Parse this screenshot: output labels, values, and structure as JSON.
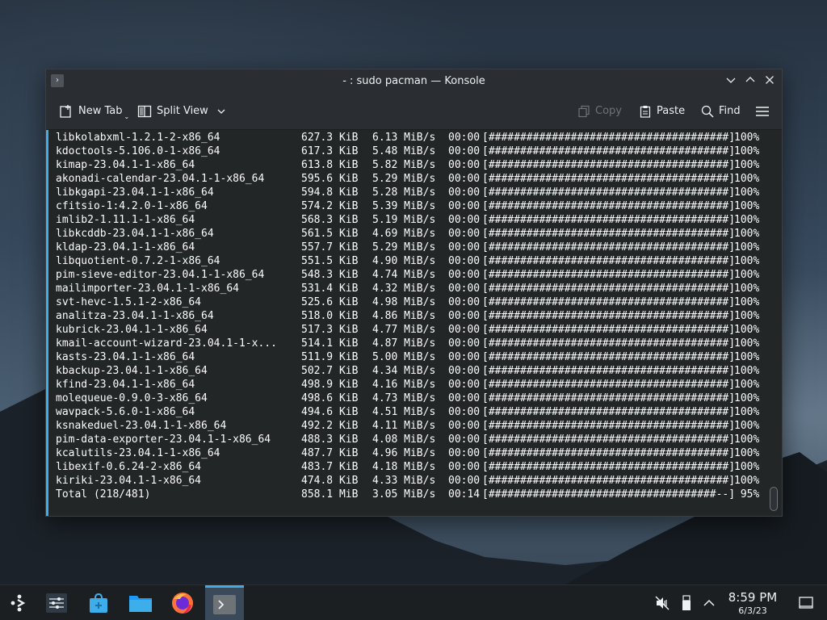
{
  "window": {
    "title": "- : sudo pacman — Konsole",
    "toolbar": {
      "new_tab": "New Tab",
      "split_view": "Split View",
      "copy": "Copy",
      "paste": "Paste",
      "find": "Find"
    }
  },
  "terminal": {
    "lines": [
      {
        "name": "libkolabxml-1.2.1-2-x86_64",
        "size": "627.3 KiB",
        "rate": "6.13 MiB/s",
        "time": "00:00",
        "bar": "[######################################]",
        "pct": "100%"
      },
      {
        "name": "kdoctools-5.106.0-1-x86_64",
        "size": "617.3 KiB",
        "rate": "5.48 MiB/s",
        "time": "00:00",
        "bar": "[######################################]",
        "pct": "100%"
      },
      {
        "name": "kimap-23.04.1-1-x86_64",
        "size": "613.8 KiB",
        "rate": "5.82 MiB/s",
        "time": "00:00",
        "bar": "[######################################]",
        "pct": "100%"
      },
      {
        "name": "akonadi-calendar-23.04.1-1-x86_64",
        "size": "595.6 KiB",
        "rate": "5.29 MiB/s",
        "time": "00:00",
        "bar": "[######################################]",
        "pct": "100%"
      },
      {
        "name": "libkgapi-23.04.1-1-x86_64",
        "size": "594.8 KiB",
        "rate": "5.28 MiB/s",
        "time": "00:00",
        "bar": "[######################################]",
        "pct": "100%"
      },
      {
        "name": "cfitsio-1:4.2.0-1-x86_64",
        "size": "574.2 KiB",
        "rate": "5.39 MiB/s",
        "time": "00:00",
        "bar": "[######################################]",
        "pct": "100%"
      },
      {
        "name": "imlib2-1.11.1-1-x86_64",
        "size": "568.3 KiB",
        "rate": "5.19 MiB/s",
        "time": "00:00",
        "bar": "[######################################]",
        "pct": "100%"
      },
      {
        "name": "libkcddb-23.04.1-1-x86_64",
        "size": "561.5 KiB",
        "rate": "4.69 MiB/s",
        "time": "00:00",
        "bar": "[######################################]",
        "pct": "100%"
      },
      {
        "name": "kldap-23.04.1-1-x86_64",
        "size": "557.7 KiB",
        "rate": "5.29 MiB/s",
        "time": "00:00",
        "bar": "[######################################]",
        "pct": "100%"
      },
      {
        "name": "libquotient-0.7.2-1-x86_64",
        "size": "551.5 KiB",
        "rate": "4.90 MiB/s",
        "time": "00:00",
        "bar": "[######################################]",
        "pct": "100%"
      },
      {
        "name": "pim-sieve-editor-23.04.1-1-x86_64",
        "size": "548.3 KiB",
        "rate": "4.74 MiB/s",
        "time": "00:00",
        "bar": "[######################################]",
        "pct": "100%"
      },
      {
        "name": "mailimporter-23.04.1-1-x86_64",
        "size": "531.4 KiB",
        "rate": "4.32 MiB/s",
        "time": "00:00",
        "bar": "[######################################]",
        "pct": "100%"
      },
      {
        "name": "svt-hevc-1.5.1-2-x86_64",
        "size": "525.6 KiB",
        "rate": "4.98 MiB/s",
        "time": "00:00",
        "bar": "[######################################]",
        "pct": "100%"
      },
      {
        "name": "analitza-23.04.1-1-x86_64",
        "size": "518.0 KiB",
        "rate": "4.86 MiB/s",
        "time": "00:00",
        "bar": "[######################################]",
        "pct": "100%"
      },
      {
        "name": "kubrick-23.04.1-1-x86_64",
        "size": "517.3 KiB",
        "rate": "4.77 MiB/s",
        "time": "00:00",
        "bar": "[######################################]",
        "pct": "100%"
      },
      {
        "name": "kmail-account-wizard-23.04.1-1-x...",
        "size": "514.1 KiB",
        "rate": "4.87 MiB/s",
        "time": "00:00",
        "bar": "[######################################]",
        "pct": "100%"
      },
      {
        "name": "kasts-23.04.1-1-x86_64",
        "size": "511.9 KiB",
        "rate": "5.00 MiB/s",
        "time": "00:00",
        "bar": "[######################################]",
        "pct": "100%"
      },
      {
        "name": "kbackup-23.04.1-1-x86_64",
        "size": "502.7 KiB",
        "rate": "4.34 MiB/s",
        "time": "00:00",
        "bar": "[######################################]",
        "pct": "100%"
      },
      {
        "name": "kfind-23.04.1-1-x86_64",
        "size": "498.9 KiB",
        "rate": "4.16 MiB/s",
        "time": "00:00",
        "bar": "[######################################]",
        "pct": "100%"
      },
      {
        "name": "molequeue-0.9.0-3-x86_64",
        "size": "498.6 KiB",
        "rate": "4.73 MiB/s",
        "time": "00:00",
        "bar": "[######################################]",
        "pct": "100%"
      },
      {
        "name": "wavpack-5.6.0-1-x86_64",
        "size": "494.6 KiB",
        "rate": "4.51 MiB/s",
        "time": "00:00",
        "bar": "[######################################]",
        "pct": "100%"
      },
      {
        "name": "ksnakeduel-23.04.1-1-x86_64",
        "size": "492.2 KiB",
        "rate": "4.11 MiB/s",
        "time": "00:00",
        "bar": "[######################################]",
        "pct": "100%"
      },
      {
        "name": "pim-data-exporter-23.04.1-1-x86_64",
        "size": "488.3 KiB",
        "rate": "4.08 MiB/s",
        "time": "00:00",
        "bar": "[######################################]",
        "pct": "100%"
      },
      {
        "name": "kcalutils-23.04.1-1-x86_64",
        "size": "487.7 KiB",
        "rate": "4.96 MiB/s",
        "time": "00:00",
        "bar": "[######################################]",
        "pct": "100%"
      },
      {
        "name": "libexif-0.6.24-2-x86_64",
        "size": "483.7 KiB",
        "rate": "4.18 MiB/s",
        "time": "00:00",
        "bar": "[######################################]",
        "pct": "100%"
      },
      {
        "name": "kiriki-23.04.1-1-x86_64",
        "size": "474.8 KiB",
        "rate": "4.33 MiB/s",
        "time": "00:00",
        "bar": "[######################################]",
        "pct": "100%"
      },
      {
        "name": "Total (218/481)",
        "size": "858.1 MiB",
        "rate": "3.05 MiB/s",
        "time": "00:14",
        "bar": "[####################################--]",
        "pct": " 95%"
      }
    ]
  },
  "taskbar": {
    "clock_time": "8:59 PM",
    "clock_date": "6/3/23",
    "items": [
      {
        "icon": "app-launcher-icon"
      },
      {
        "icon": "system-settings-icon"
      },
      {
        "icon": "discover-store-icon"
      },
      {
        "icon": "dolphin-files-icon"
      },
      {
        "icon": "firefox-icon"
      },
      {
        "icon": "konsole-icon"
      }
    ]
  },
  "colors": {
    "accent": "#3daee9",
    "terminal_bg": "#232627",
    "terminal_fg": "#fcfcfc"
  }
}
